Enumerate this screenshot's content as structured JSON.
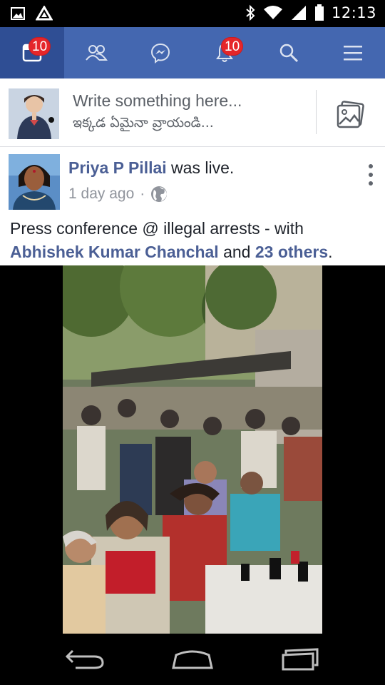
{
  "status_bar": {
    "time": "12:13",
    "icons": [
      "image-icon",
      "drive-icon",
      "bluetooth-icon",
      "wifi-icon",
      "signal-icon",
      "battery-icon"
    ]
  },
  "nav": {
    "items": [
      {
        "name": "news-feed",
        "icon": "news-feed-icon",
        "badge": "10",
        "active": true
      },
      {
        "name": "friends",
        "icon": "friends-icon",
        "badge": null,
        "active": false
      },
      {
        "name": "messenger",
        "icon": "messenger-icon",
        "badge": null,
        "active": false
      },
      {
        "name": "notifications",
        "icon": "bell-icon",
        "badge": "10",
        "active": false
      },
      {
        "name": "search",
        "icon": "search-icon",
        "badge": null,
        "active": false
      },
      {
        "name": "menu",
        "icon": "hamburger-menu-icon",
        "badge": null,
        "active": false
      }
    ]
  },
  "composer": {
    "placeholder_line1": "Write something here...",
    "placeholder_line2": "ఇక్కడ ఏమైనా వ్రాయండి..."
  },
  "post": {
    "author": "Priya P Pillai",
    "action": " was live.",
    "time": "1 day ago",
    "separator": "·",
    "text_before": "Press conference @ illegal arrests - with",
    "tagged_person": "Abhishek Kumar Chanchal",
    "text_and": " and ",
    "tagged_others": "23 others",
    "text_end": "."
  },
  "colors": {
    "nav_bg": "#4467b0",
    "nav_active_bg": "#2f4e94",
    "badge_red": "#e5262a",
    "link_blue": "#4b5f95"
  }
}
